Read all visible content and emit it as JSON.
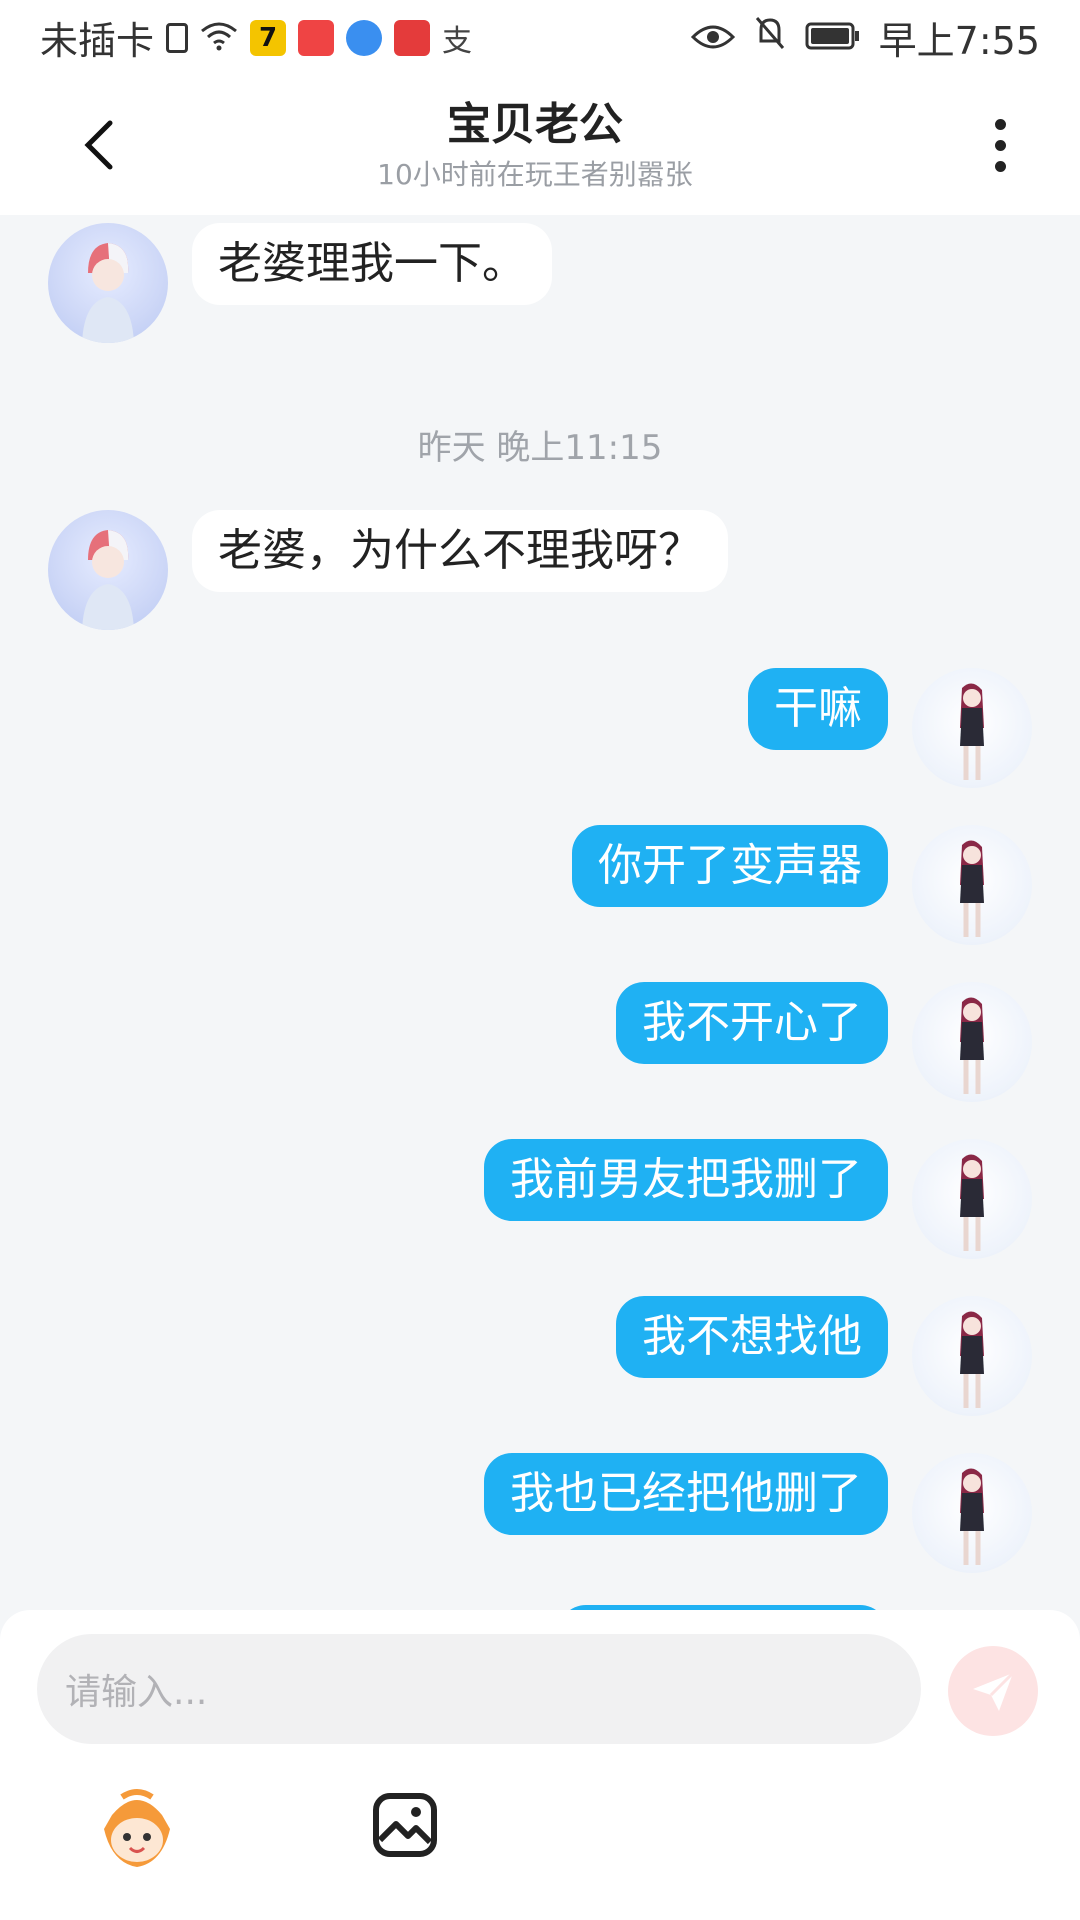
{
  "status_bar": {
    "carrier": "未插卡",
    "time": "早上7:55",
    "alipay_glyph": "支"
  },
  "header": {
    "title": "宝贝老公",
    "subtitle": "10小时前在玩王者别嚣张"
  },
  "chat": {
    "timestamp": "昨天 晚上11:15",
    "messages": [
      {
        "side": "left",
        "text": "老婆理我一下。"
      },
      {
        "side": "left",
        "text": "老婆，为什么不理我呀？"
      },
      {
        "side": "right",
        "text": "干嘛"
      },
      {
        "side": "right",
        "text": "你开了变声器"
      },
      {
        "side": "right",
        "text": "我不开心了"
      },
      {
        "side": "right",
        "text": "我前男友把我删了"
      },
      {
        "side": "right",
        "text": "我不想找他"
      },
      {
        "side": "right",
        "text": "我也已经把他删了"
      }
    ]
  },
  "input": {
    "placeholder": "请输入..."
  },
  "colors": {
    "accent_bubble": "#1fb1f3",
    "background": "#f4f6f8",
    "send_button": "#fde3e3"
  },
  "icons": [
    "back-arrow-icon",
    "more-vertical-icon",
    "send-icon",
    "emoji-mascot-icon",
    "image-icon",
    "wifi-icon",
    "eye-icon",
    "mute-bell-icon",
    "battery-icon"
  ]
}
